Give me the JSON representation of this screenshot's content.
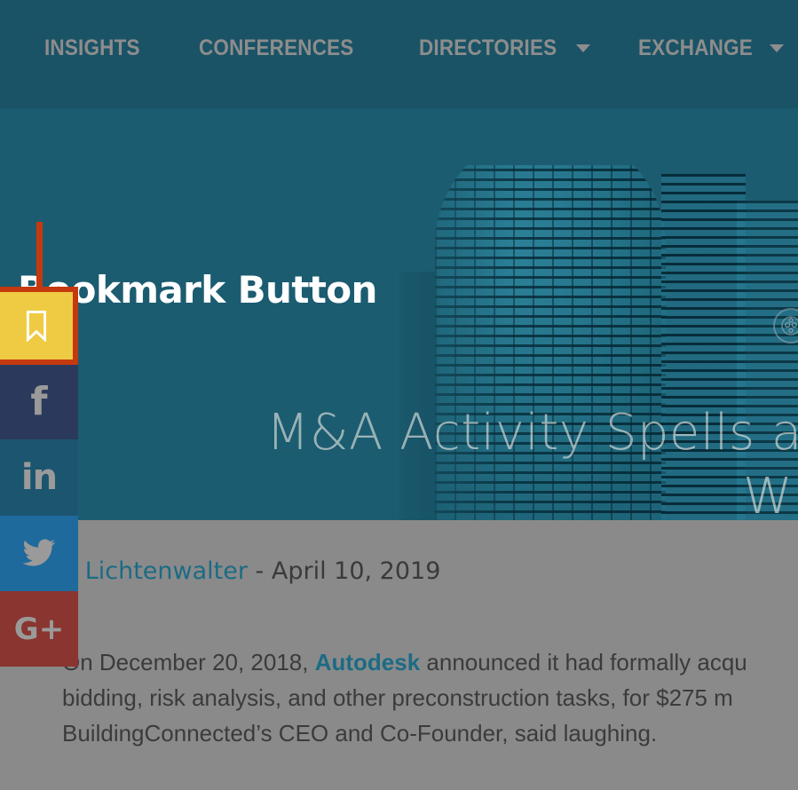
{
  "nav": {
    "items": [
      {
        "label": "INSIGHTS",
        "has_dropdown": false
      },
      {
        "label": "CONFERENCES",
        "has_dropdown": false
      },
      {
        "label": "DIRECTORIES",
        "has_dropdown": true
      },
      {
        "label": "EXCHANGE",
        "has_dropdown": true
      }
    ]
  },
  "page": {
    "title": "Bookmark Button"
  },
  "hero": {
    "headline_line1": "M&A Activity Spells a",
    "headline_line2": "W",
    "accessibility_icon": "accessibility-icon"
  },
  "article": {
    "author": "n Lichtenwalter",
    "separator": " - ",
    "date": "April 10, 2019",
    "paragraph_lines": [
      "On December 20, 2018, ",
      "bidding, risk analysis, and other preconstruction tasks, for $275 m",
      "BuildingConnected’s CEO and Co-Founder, said laughing."
    ],
    "brand_link": "Autodesk",
    "line1_after_brand": " announced it had formally acqu"
  },
  "social": {
    "buttons": [
      {
        "name": "bookmark",
        "icon": "bookmark-icon",
        "label": "Bookmark",
        "color": "#efcb44",
        "highlight": "#c5390f",
        "active": true
      },
      {
        "name": "facebook",
        "icon": "facebook-icon",
        "label": "Share on Facebook",
        "color": "#2b3a5c",
        "glyph": "f"
      },
      {
        "name": "linkedin",
        "icon": "linkedin-icon",
        "label": "Share on LinkedIn",
        "color": "#1c5570",
        "glyph": "in"
      },
      {
        "name": "twitter",
        "icon": "twitter-icon",
        "label": "Share on Twitter",
        "color": "#1f6a9c",
        "glyph": "twitter-bird"
      },
      {
        "name": "googleplus",
        "icon": "google-plus-icon",
        "label": "Share on Google Plus",
        "color": "#8a3530",
        "glyph": "G+"
      }
    ],
    "connector_color": "#c5390f"
  },
  "colors": {
    "navbar": "#1a5366",
    "hero_bg": "#1c5c70",
    "content_bg": "#8a8a8a",
    "nav_text": "#8d8d8d",
    "accent_orange": "#c5390f",
    "accent_yellow": "#efcb44",
    "link_teal": "#1c6b84"
  }
}
